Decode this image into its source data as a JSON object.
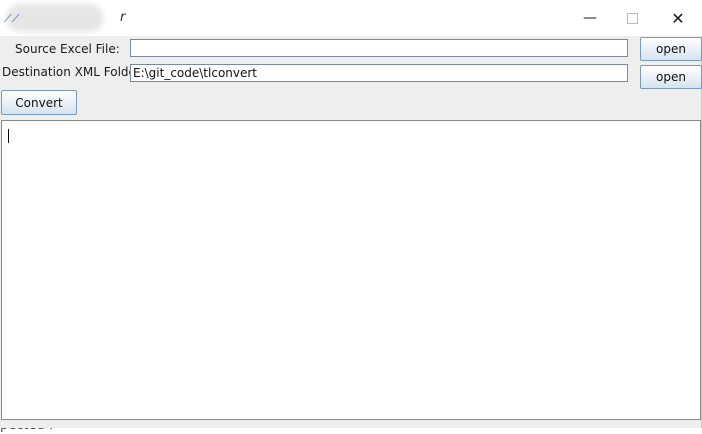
{
  "window": {
    "title": "r",
    "app_icon": "java-app-icon",
    "controls": {
      "minimize_glyph": "—",
      "close_glyph": "✕"
    }
  },
  "form": {
    "source_label": "Source Excel File:",
    "source_value": "",
    "dest_label": "Destination XML Folder:",
    "dest_value": "E:\\git_code\\tlconvert",
    "open_label_1": "open",
    "open_label_2": "open",
    "convert_label": "Convert"
  },
  "output": {
    "text": ""
  },
  "background": {
    "behind_text": "pected :"
  },
  "colors": {
    "window_bg": "#eeeeee",
    "button_top": "#ffffff",
    "button_bottom": "#d6e3f0",
    "button_border": "#7a9abb"
  }
}
